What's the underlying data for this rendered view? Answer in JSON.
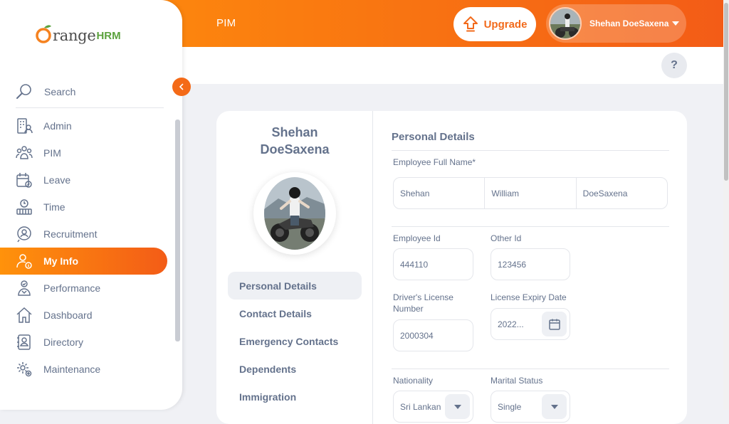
{
  "header": {
    "module_title": "PIM",
    "upgrade_label": "Upgrade",
    "user_name": "Shehan DoeSaxena",
    "help_label": "?"
  },
  "brand": {
    "text": "range",
    "hrm": "HRM"
  },
  "sidebar": {
    "search_label": "Search",
    "items": [
      {
        "label": "Admin",
        "icon": "admin-icon"
      },
      {
        "label": "PIM",
        "icon": "pim-icon"
      },
      {
        "label": "Leave",
        "icon": "leave-icon"
      },
      {
        "label": "Time",
        "icon": "time-icon"
      },
      {
        "label": "Recruitment",
        "icon": "recruitment-icon"
      },
      {
        "label": "My Info",
        "icon": "myinfo-icon",
        "active": true
      },
      {
        "label": "Performance",
        "icon": "performance-icon"
      },
      {
        "label": "Dashboard",
        "icon": "dashboard-icon"
      },
      {
        "label": "Directory",
        "icon": "directory-icon"
      },
      {
        "label": "Maintenance",
        "icon": "maintenance-icon"
      }
    ]
  },
  "profile": {
    "first_line": "Shehan",
    "second_line": "DoeSaxena",
    "tabs": [
      "Personal Details",
      "Contact Details",
      "Emergency Contacts",
      "Dependents",
      "Immigration"
    ]
  },
  "form": {
    "section_title": "Personal Details",
    "full_name_label": "Employee Full Name*",
    "first_name": "Shehan",
    "middle_name": "William",
    "last_name": "DoeSaxena",
    "employee_id_label": "Employee Id",
    "employee_id": "444110",
    "other_id_label": "Other Id",
    "other_id": "123456",
    "license_label_1": "Driver's License",
    "license_label_2": "Number",
    "license_number": "2000304",
    "expiry_label": "License Expiry Date",
    "expiry_value": "2022...",
    "nationality_label": "Nationality",
    "nationality_value": "Sri Lankan",
    "marital_label": "Marital Status",
    "marital_value": "Single"
  },
  "colors": {
    "accent_start": "#ff920b",
    "accent_end": "#f35c17",
    "text": "#64728c"
  }
}
